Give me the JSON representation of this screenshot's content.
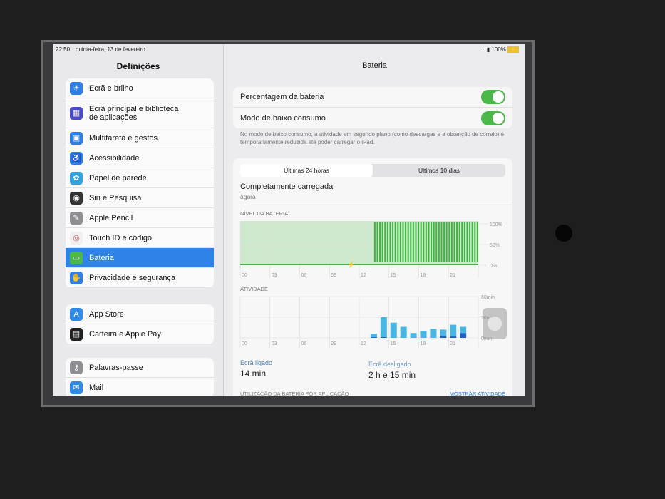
{
  "status": {
    "time": "22:50",
    "date": "quinta-feira, 13 de fevereiro",
    "battery": "100%"
  },
  "sidebar": {
    "title": "Definições",
    "groups": [
      [
        {
          "label": "Ecrã e brilho",
          "icon": "sun-icon",
          "color": "#2f7fe6",
          "g": "☀"
        },
        {
          "label": "Ecrã principal e biblioteca de aplicações",
          "icon": "home-grid-icon",
          "color": "#4b4bc8",
          "g": "▦"
        },
        {
          "label": "Multitarefa e gestos",
          "icon": "multitask-icon",
          "color": "#2f7fe6",
          "g": "▣"
        },
        {
          "label": "Acessibilidade",
          "icon": "accessibility-icon",
          "color": "#2f7fe6",
          "g": "♿"
        },
        {
          "label": "Papel de parede",
          "icon": "wallpaper-icon",
          "color": "#33a3e0",
          "g": "✿"
        },
        {
          "label": "Siri e Pesquisa",
          "icon": "siri-icon",
          "color": "#333",
          "g": "◉"
        },
        {
          "label": "Apple Pencil",
          "icon": "pencil-icon",
          "color": "#8e8e93",
          "g": "✎"
        },
        {
          "label": "Touch ID e código",
          "icon": "fingerprint-icon",
          "color": "#f0f0f0",
          "g": "◎"
        },
        {
          "label": "Bateria",
          "icon": "battery-icon",
          "color": "#4bb84a",
          "g": "▭"
        },
        {
          "label": "Privacidade e segurança",
          "icon": "hand-icon",
          "color": "#2f7fe6",
          "g": "✋"
        }
      ],
      [
        {
          "label": "App Store",
          "icon": "appstore-icon",
          "color": "#2f8ae8",
          "g": "A"
        },
        {
          "label": "Carteira e Apple Pay",
          "icon": "wallet-icon",
          "color": "#222",
          "g": "▤"
        }
      ],
      [
        {
          "label": "Palavras-passe",
          "icon": "key-icon",
          "color": "#8e8e93",
          "g": "⚷"
        },
        {
          "label": "Mail",
          "icon": "mail-icon",
          "color": "#2f8ae8",
          "g": "✉"
        }
      ]
    ]
  },
  "main": {
    "title": "Bateria",
    "battery_percentage": "Percentagem da bateria",
    "low_power": "Modo de baixo consumo",
    "note": "No modo de baixo consumo, a atividade em segundo plano (como descargas e a obtenção de correio) é temporariamente reduzida até poder carregar o iPad.",
    "tabs": [
      "Últimas 24 horas",
      "Últimos 10 dias"
    ],
    "charged": "Completamente carregada",
    "charged_when": "agora",
    "screen_on_label": "Ecrã ligado",
    "screen_on": "14 min",
    "screen_off_label": "Ecrã desligado",
    "screen_off": "2 h e 15 min",
    "usage_header": "UTILIZAÇÃO DA BATERIA POR APLICAÇÃO",
    "show_activity": "MOSTRAR ATIVIDADE"
  },
  "chart_data": [
    {
      "type": "bar",
      "title": "NÍVEL DA BATERIA",
      "x_ticks": [
        "00",
        "03",
        "06",
        "09",
        "12",
        "15",
        "18",
        "21"
      ],
      "y_ticks": [
        "100%",
        "50%",
        "0%"
      ],
      "ylim": [
        0,
        100
      ],
      "note": "charging from ~13:30, level 100%",
      "charging_from_hour": 13.5,
      "level": 100
    },
    {
      "type": "bar",
      "title": "ATIVIDADE",
      "x_ticks": [
        "00",
        "03",
        "06",
        "09",
        "12",
        "15",
        "18",
        "21"
      ],
      "date": "13/02",
      "y_ticks": [
        "60min",
        "30min",
        "0min"
      ],
      "ylim": [
        0,
        60
      ],
      "hours": [
        13,
        14,
        15,
        16,
        17,
        18,
        19,
        20,
        21,
        22
      ],
      "series": [
        {
          "name": "Ecrã ligado",
          "values": [
            1,
            1,
            0,
            0,
            0,
            0,
            0,
            3,
            2,
            7
          ]
        },
        {
          "name": "Ecrã desligado",
          "values": [
            5,
            29,
            22,
            16,
            7,
            10,
            13,
            9,
            17,
            9
          ]
        }
      ]
    }
  ]
}
